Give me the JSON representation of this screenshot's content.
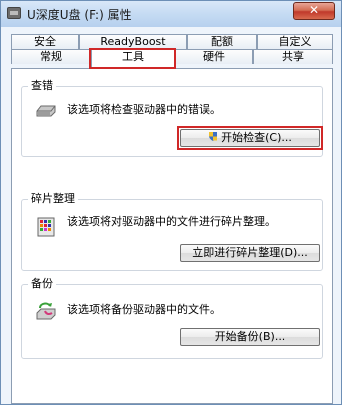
{
  "window": {
    "title": "U深度U盘 (F:) 属性",
    "close_label": "✕"
  },
  "tabs": {
    "row1": [
      "安全",
      "ReadyBoost",
      "配额",
      "自定义"
    ],
    "row2": [
      "常规",
      "工具",
      "硬件",
      "共享"
    ],
    "active": "工具"
  },
  "groups": {
    "check": {
      "title": "查错",
      "description": "该选项将检查驱动器中的错误。",
      "button": "开始检查(C)...",
      "icon": "drive-icon"
    },
    "defrag": {
      "title": "碎片整理",
      "description": "该选项将对驱动器中的文件进行碎片整理。",
      "button": "立即进行碎片整理(D)...",
      "icon": "defrag-icon"
    },
    "backup": {
      "title": "备份",
      "description": "该选项将备份驱动器中的文件。",
      "button": "开始备份(B)...",
      "icon": "backup-icon"
    }
  },
  "colors": {
    "highlight": "#d02828",
    "title_bar": "#c5dbf3",
    "close": "#c0392b"
  }
}
